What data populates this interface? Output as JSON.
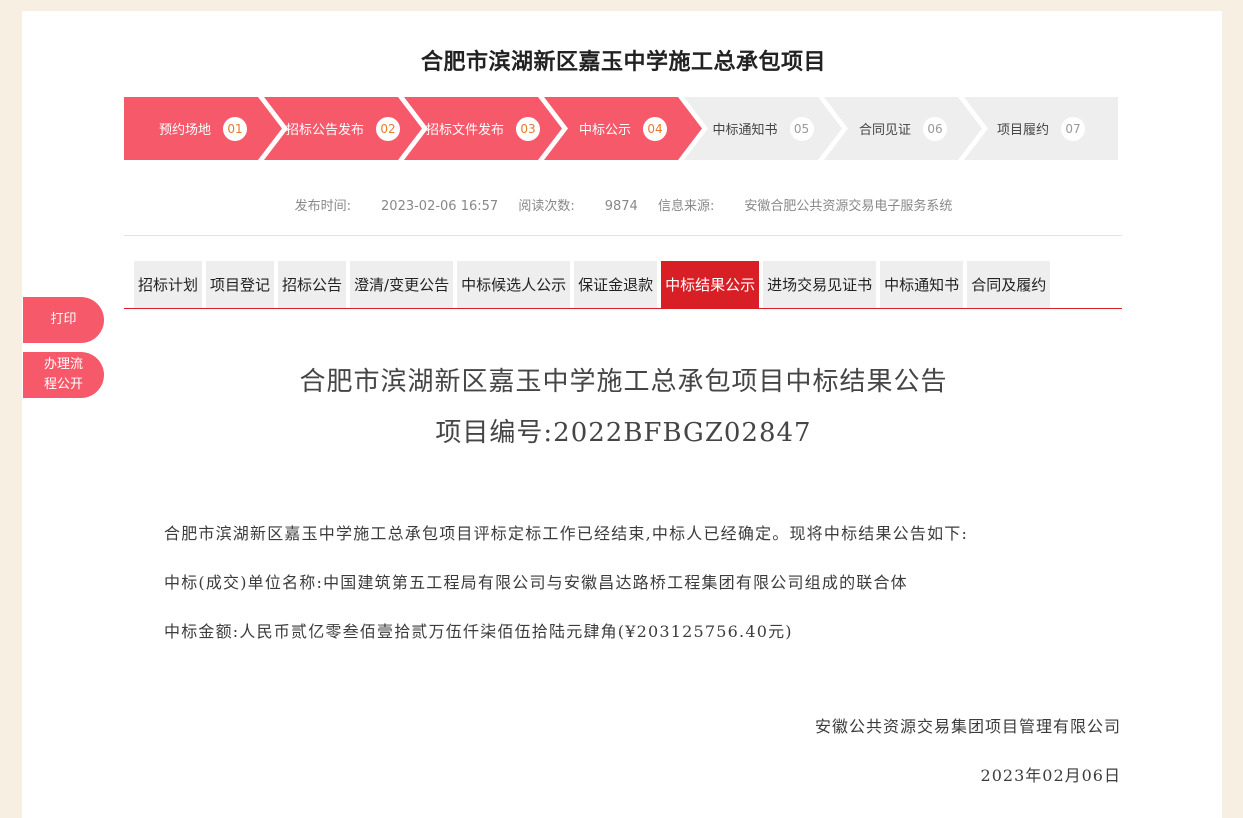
{
  "header": {
    "title": "合肥市滨湖新区嘉玉中学施工总承包项目"
  },
  "steps": [
    {
      "label": "预约场地",
      "num": "01",
      "state": "active"
    },
    {
      "label": "招标公告发布",
      "num": "02",
      "state": "active"
    },
    {
      "label": "招标文件发布",
      "num": "03",
      "state": "active"
    },
    {
      "label": "中标公示",
      "num": "04",
      "state": "active"
    },
    {
      "label": "中标通知书",
      "num": "05",
      "state": "inactive"
    },
    {
      "label": "合同见证",
      "num": "06",
      "state": "inactive"
    },
    {
      "label": "项目履约",
      "num": "07",
      "state": "inactive"
    }
  ],
  "meta": {
    "publish_label": "发布时间:",
    "publish_value": "2023-02-06 16:57",
    "views_label": "阅读次数:",
    "views_value": "9874",
    "source_label": "信息来源:",
    "source_value": "安徽合肥公共资源交易电子服务系统"
  },
  "tabs": [
    {
      "label": "招标计划",
      "active": false
    },
    {
      "label": "项目登记",
      "active": false
    },
    {
      "label": "招标公告",
      "active": false
    },
    {
      "label": "澄清/变更公告",
      "active": false
    },
    {
      "label": "中标候选人公示",
      "active": false
    },
    {
      "label": "保证金退款",
      "active": false
    },
    {
      "label": "中标结果公示",
      "active": true
    },
    {
      "label": "进场交易见证书",
      "active": false
    },
    {
      "label": "中标通知书",
      "active": false
    },
    {
      "label": "合同及履约",
      "active": false
    }
  ],
  "side": {
    "print_label": "打印",
    "flow_label_1": "办理流",
    "flow_label_2": "程公开"
  },
  "document": {
    "title": "合肥市滨湖新区嘉玉中学施工总承包项目中标结果公告",
    "project_no": "项目编号:2022BFBGZ02847",
    "para1": "合肥市滨湖新区嘉玉中学施工总承包项目评标定标工作已经结束,中标人已经确定。现将中标结果公告如下:",
    "para2": "中标(成交)单位名称:中国建筑第五工程局有限公司与安徽昌达路桥工程集团有限公司组成的联合体",
    "para3": "中标金额:人民币贰亿零叁佰壹拾贰万伍仟柒佰伍拾陆元肆角(¥203125756.40元)",
    "signer": "安徽公共资源交易集团项目管理有限公司",
    "date": "2023年02月06日"
  },
  "colors": {
    "accent": "#f5596a",
    "tab_active": "#d91f26",
    "bg": "#f8efe3"
  }
}
